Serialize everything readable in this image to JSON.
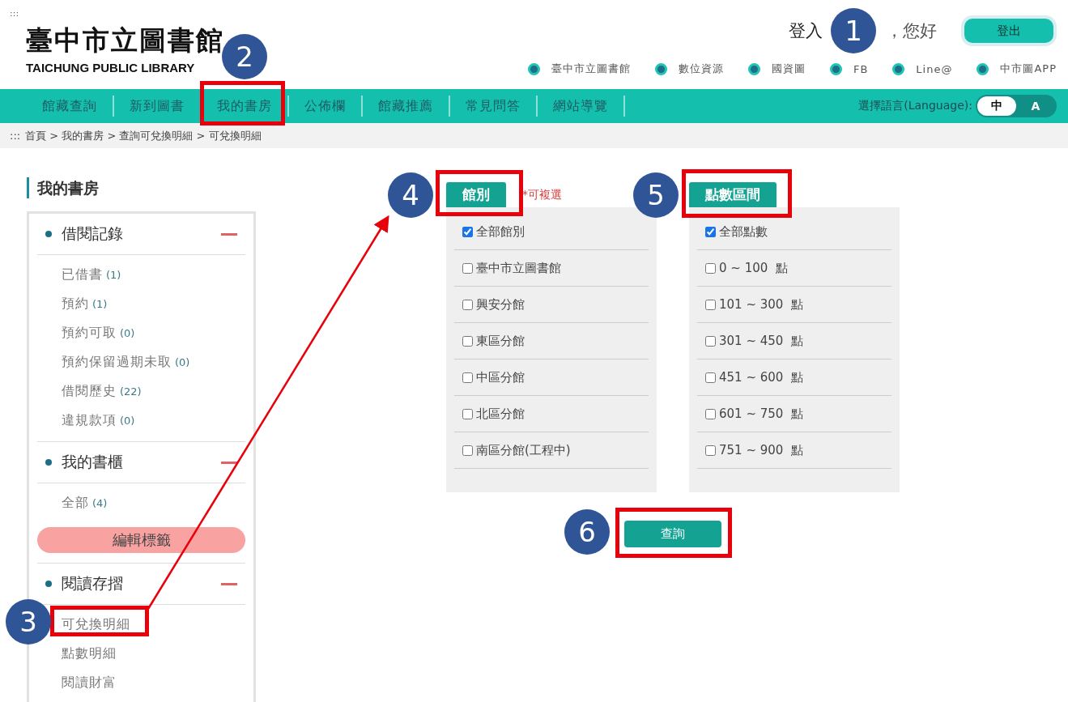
{
  "header": {
    "skip_mark": ":::",
    "logo_title": "臺中市立圖書館",
    "logo_subtitle": "TAICHUNG PUBLIC LIBRARY",
    "greeting_prefix": "登入",
    "greeting_suffix": "，您好",
    "logout": "登出",
    "links": [
      "臺中市立圖書館",
      "數位資源",
      "國資圖",
      "FB",
      "Line@",
      "中市圖APP"
    ]
  },
  "nav": {
    "items": [
      "館藏查詢",
      "新到圖書",
      "我的書房",
      "公佈欄",
      "館藏推薦",
      "常見問答",
      "網站導覽"
    ],
    "language_label": "選擇語言(Language):",
    "languages": [
      {
        "label": "中",
        "selected": true
      },
      {
        "label": "A",
        "selected": false
      }
    ]
  },
  "breadcrumb": {
    "mark": ":::",
    "path": "首頁 > 我的書房 > 查詢可兌換明細 > 可兌換明細"
  },
  "sidebar": {
    "title": "我的書房",
    "sections": [
      {
        "title": "借閱記錄",
        "expanded": true,
        "items": [
          {
            "label": "已借書",
            "count": "(1)"
          },
          {
            "label": "預約",
            "count": "(1)"
          },
          {
            "label": "預約可取",
            "count": "(0)"
          },
          {
            "label": "預約保留過期未取",
            "count": "(0)"
          },
          {
            "label": "借閱歷史",
            "count": "(22)"
          },
          {
            "label": "違規款項",
            "count": "(0)"
          }
        ]
      },
      {
        "title": "我的書櫃",
        "expanded": true,
        "items": [
          {
            "label": "全部",
            "count": "(4)"
          }
        ],
        "action": "編輯標籤"
      },
      {
        "title": "閱讀存摺",
        "expanded": true,
        "items": [
          {
            "label": "可兌換明細"
          },
          {
            "label": "點數明細"
          },
          {
            "label": "閱讀財富"
          }
        ]
      }
    ]
  },
  "filters": [
    {
      "label": "館別",
      "note": "*可複選",
      "options": [
        {
          "label": "全部館別",
          "checked": true
        },
        {
          "label": "臺中市立圖書館",
          "checked": false
        },
        {
          "label": "興安分館",
          "checked": false
        },
        {
          "label": "東區分館",
          "checked": false
        },
        {
          "label": "中區分館",
          "checked": false
        },
        {
          "label": "北區分館",
          "checked": false
        },
        {
          "label": "南區分館(工程中)",
          "checked": false
        }
      ]
    },
    {
      "label": "點數區間",
      "options": [
        {
          "label": "全部點數",
          "checked": true
        },
        {
          "label": "0 ~ 100  點",
          "checked": false
        },
        {
          "label": "101 ~ 300  點",
          "checked": false
        },
        {
          "label": "301 ~ 450  點",
          "checked": false
        },
        {
          "label": "451 ~ 600  點",
          "checked": false
        },
        {
          "label": "601 ~ 750  點",
          "checked": false
        },
        {
          "label": "751 ~ 900  點",
          "checked": false
        }
      ]
    }
  ],
  "search_button": "查詢",
  "markers": [
    "1",
    "2",
    "3",
    "4",
    "5",
    "6"
  ]
}
